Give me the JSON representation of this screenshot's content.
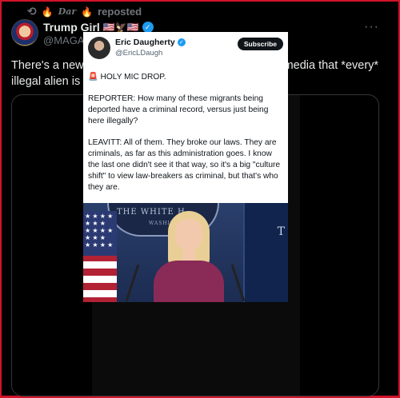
{
  "repost": {
    "icon": "repost-icon",
    "name": "Dar",
    "label": "reposted"
  },
  "author": {
    "display_name": "Trump Girl",
    "flags": "🇺🇸🦅🇺🇸",
    "handle": "@MAGA__Patriot",
    "verified_color": "#1d9bf0"
  },
  "more_label": "···",
  "tweet": {
    "text": "There's a new Sheriff in town and he's reminding the media that *every* illegal alien is a criminal and subject to deportation!!"
  },
  "embedded_card": {
    "name": "Eric Daugherty",
    "handle": "@EricLDaugh",
    "subscribe_label": "Subscribe",
    "paragraphs": [
      "🚨 HOLY MIC DROP.",
      "REPORTER: How many of these migrants being deported have a criminal record, versus just being here illegally?",
      "LEAVITT: All of them. They broke our laws. They are criminals, as far as this administration goes. I know the last one didn't see it that way, so it's a big \"culture shift\" to view law-breakers as criminal, but that's who they are."
    ]
  },
  "scene": {
    "seal_text": "THE WHITE H",
    "seal_sub": "WASHINGTO",
    "panel_text": "T"
  },
  "colors": {
    "background": "#000000",
    "frame_border": "#d2132a",
    "text_primary": "#e7e9ea",
    "text_secondary": "#71767b"
  }
}
